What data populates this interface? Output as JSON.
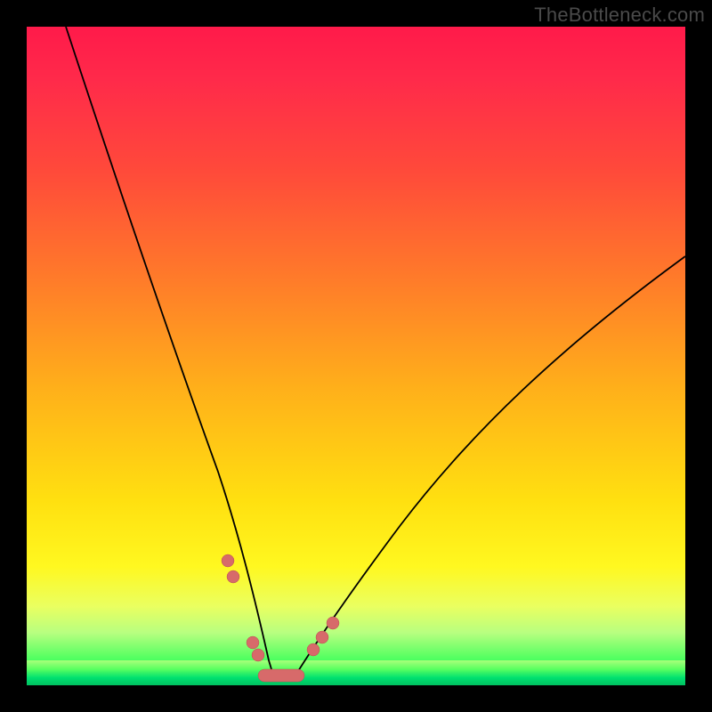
{
  "watermark": "TheBottleneck.com",
  "colors": {
    "page_bg": "#000000",
    "gradient_top": "#ff1a4a",
    "gradient_mid": "#ffe010",
    "gradient_bottom": "#00e070",
    "curve": "#000000",
    "marker": "#d76a6a"
  },
  "chart_data": {
    "type": "line",
    "title": "",
    "xlabel": "",
    "ylabel": "",
    "xlim": [
      0,
      100
    ],
    "ylim": [
      0,
      100
    ],
    "grid": false,
    "series": [
      {
        "name": "left-curve",
        "x": [
          6,
          10,
          14,
          18,
          22,
          26,
          30,
          33,
          35,
          37
        ],
        "values": [
          100,
          85,
          70,
          55,
          42,
          30,
          18,
          9,
          3,
          0
        ]
      },
      {
        "name": "right-curve",
        "x": [
          40,
          44,
          50,
          58,
          66,
          76,
          86,
          100
        ],
        "values": [
          0,
          4,
          10,
          18,
          27,
          38,
          49,
          65
        ]
      }
    ],
    "markers": [
      {
        "curve": "left-curve",
        "x": 30,
        "y": 18
      },
      {
        "curve": "left-curve",
        "x": 31,
        "y": 15
      },
      {
        "curve": "left-curve",
        "x": 34,
        "y": 5
      },
      {
        "curve": "left-curve",
        "x": 35,
        "y": 3
      },
      {
        "curve": "right-curve",
        "x": 44,
        "y": 4
      },
      {
        "curve": "right-curve",
        "x": 45.5,
        "y": 6
      },
      {
        "curve": "right-curve",
        "x": 47,
        "y": 8
      }
    ],
    "bottom_bar": {
      "x_start": 35,
      "x_end": 42,
      "y": 0
    }
  }
}
